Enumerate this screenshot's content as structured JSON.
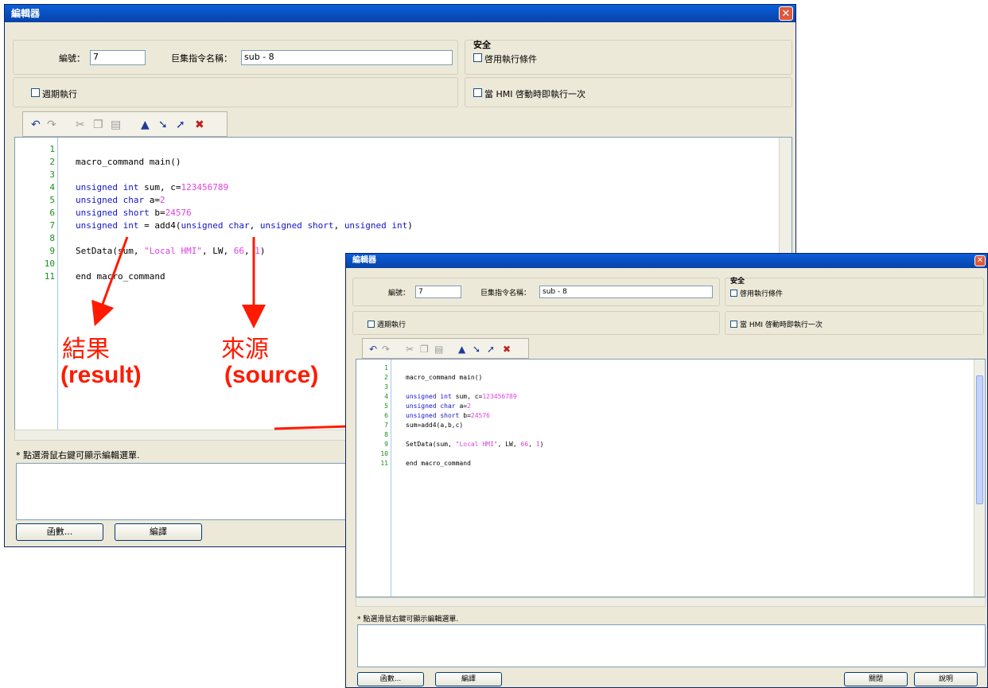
{
  "window": {
    "title": "編輯器",
    "close_glyph": "✕",
    "id_label": "編號：",
    "id_value": "7",
    "name_label": "巨集指令名稱：",
    "name_value": "sub - 8",
    "security_title": "安全",
    "enable_condition_label": "啓用執行條件",
    "periodic_label": "週期執行",
    "run_once_label": "當 HMI 啓動時即執行一次",
    "hint": "* 點選滑鼠右鍵可顯示編輯選單.",
    "functions_button": "函數...",
    "compile_button": "編譯",
    "close_button": "關閉",
    "help_button": "說明"
  },
  "toolbar_icons": [
    "undo-icon",
    "redo-icon",
    "cut-icon",
    "copy-icon",
    "paste-icon",
    "bookmark-toggle-icon",
    "bookmark-next-icon",
    "bookmark-prev-icon",
    "bookmark-clear-icon"
  ],
  "editor_back": {
    "line_numbers": [
      "1",
      "2",
      "3",
      "4",
      "5",
      "6",
      "7",
      "8",
      "9",
      "10",
      "11"
    ],
    "lines": [
      "",
      "macro_command main()",
      "",
      "unsigned int sum, c=123456789",
      "unsigned char a=2",
      "unsigned short b=24576",
      "unsigned int = add4(unsigned char, unsigned short, unsigned int)",
      "",
      "SetData(sum, \"Local HMI\", LW, 66, 1)",
      "",
      "end macro_command"
    ]
  },
  "editor_front": {
    "line_numbers": [
      "1",
      "2",
      "3",
      "4",
      "5",
      "6",
      "7",
      "8",
      "9",
      "10",
      "11"
    ],
    "lines": [
      "",
      "macro_command main()",
      "",
      "unsigned int sum, c=123456789",
      "unsigned char a=2",
      "unsigned short b=24576",
      "sum=add4(a,b,c)",
      "",
      "SetData(sum, \"Local HMI\", LW, 66, 1)",
      "",
      "end macro_command"
    ]
  },
  "annotations": {
    "result_zh": "結果",
    "result_en": "(result)",
    "source_zh": "來源",
    "source_en": "(source)"
  },
  "colors": {
    "annotation": "#ff1a00",
    "keyword": "#1414c8",
    "literal": "#e040e0",
    "line_number": "#1a8f1a"
  }
}
